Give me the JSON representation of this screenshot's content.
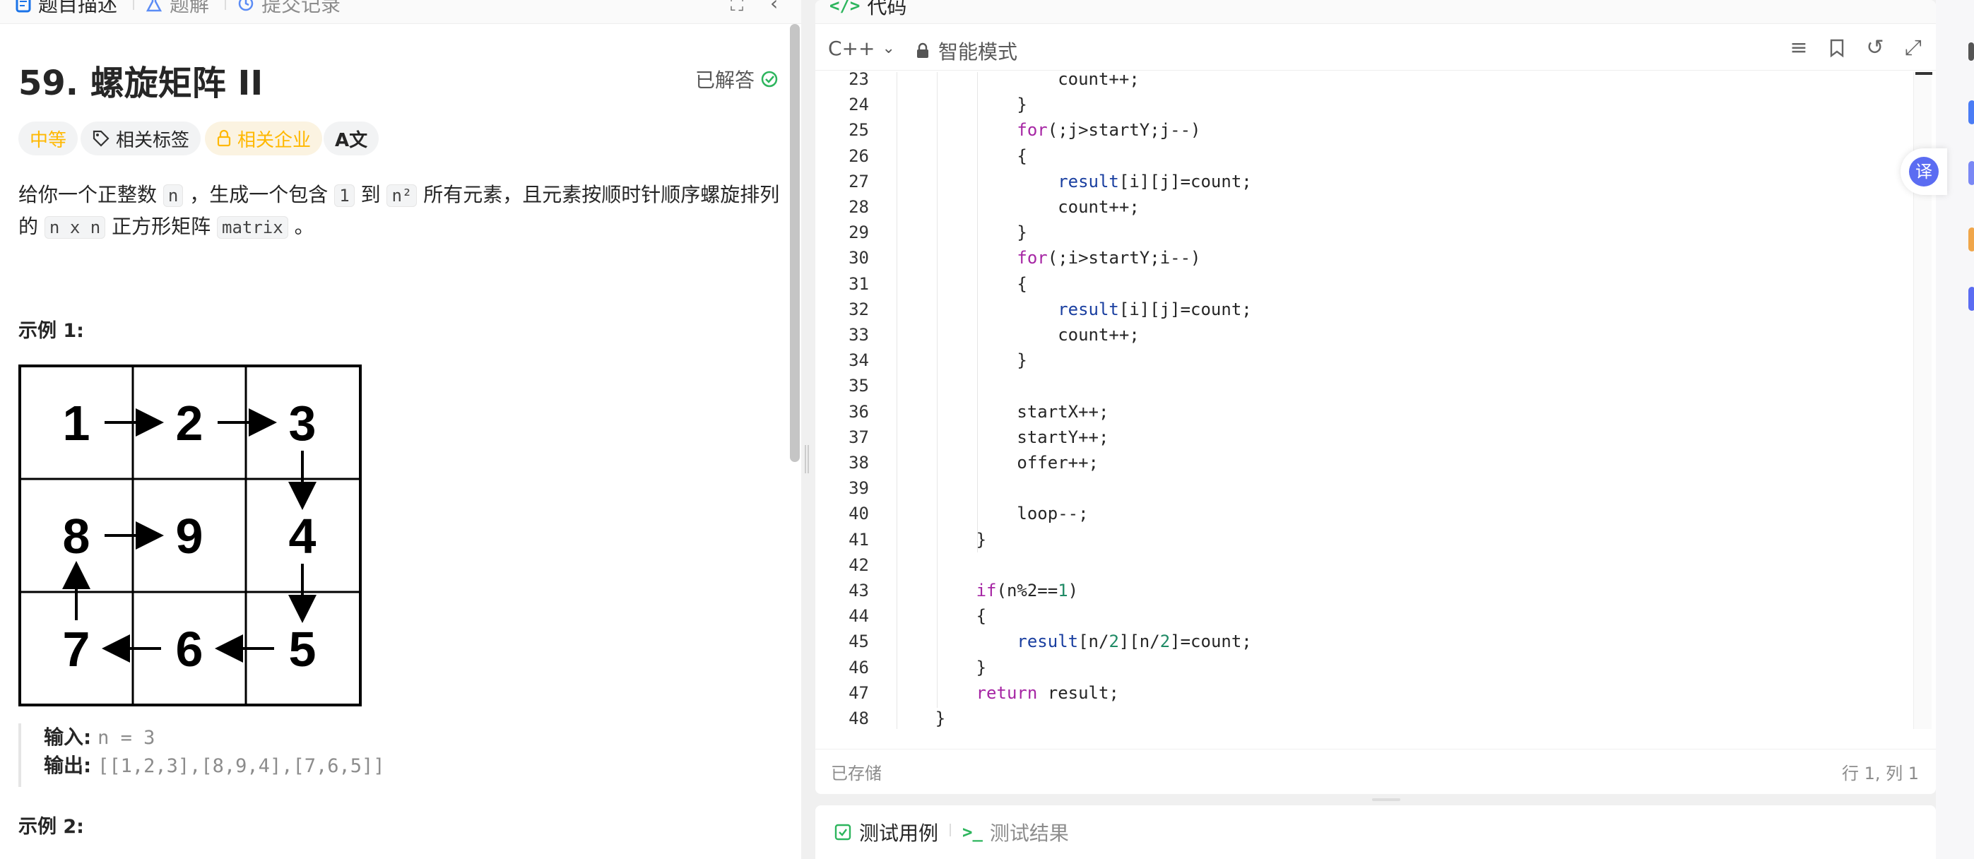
{
  "left_tabs": [
    "题目描述",
    "题解",
    "提交记录"
  ],
  "problem": {
    "title": "59. 螺旋矩阵 II",
    "status": "已解答",
    "tags": {
      "difficulty": "中等",
      "related_tags": "相关标签",
      "related_companies": "相关企业",
      "translate": "A文"
    },
    "desc": {
      "p1": "给你一个正整数",
      "n": "n",
      "p2": "，生成一个包含",
      "one": "1",
      "p3": "到",
      "n2": "n²",
      "p4": "所有元素，且元素按顺时针顺序螺旋排列",
      "p5": "的",
      "nxn": "n x n",
      "p6": "正方形矩阵",
      "matrix": "matrix",
      "p7": "。"
    },
    "example1_heading": "示例 1:",
    "grid_numbers": [
      "1",
      "2",
      "3",
      "8",
      "9",
      "4",
      "7",
      "6",
      "5"
    ],
    "input_label": "输入:",
    "input_value": "n = 3",
    "output_label": "输出:",
    "output_value": "[[1,2,3],[8,9,4],[7,6,5]]",
    "example2_heading": "示例 2:"
  },
  "code_panel": {
    "title": "代码",
    "language": "C++",
    "mode": "智能模式",
    "status_saved": "已存储",
    "cursor_position": "行 1, 列 1",
    "lines": [
      {
        "n": "23",
        "text": "                count++;"
      },
      {
        "n": "24",
        "text": "            }"
      },
      {
        "n": "25",
        "text": "            for(;j>startY;j--)"
      },
      {
        "n": "26",
        "text": "            {"
      },
      {
        "n": "27",
        "text": "                result[i][j]=count;"
      },
      {
        "n": "28",
        "text": "                count++;"
      },
      {
        "n": "29",
        "text": "            }"
      },
      {
        "n": "30",
        "text": "            for(;i>startY;i--)"
      },
      {
        "n": "31",
        "text": "            {"
      },
      {
        "n": "32",
        "text": "                result[i][j]=count;"
      },
      {
        "n": "33",
        "text": "                count++;"
      },
      {
        "n": "34",
        "text": "            }"
      },
      {
        "n": "35",
        "text": ""
      },
      {
        "n": "36",
        "text": "            startX++;"
      },
      {
        "n": "37",
        "text": "            startY++;"
      },
      {
        "n": "38",
        "text": "            offer++;"
      },
      {
        "n": "39",
        "text": ""
      },
      {
        "n": "40",
        "text": "            loop--;"
      },
      {
        "n": "41",
        "text": "        }"
      },
      {
        "n": "42",
        "text": ""
      },
      {
        "n": "43",
        "text": "        if(n%2==1)"
      },
      {
        "n": "44",
        "text": "        {"
      },
      {
        "n": "45",
        "text": "            result[n/2][n/2]=count;"
      },
      {
        "n": "46",
        "text": "        }"
      },
      {
        "n": "47",
        "text": "        return result;"
      },
      {
        "n": "48",
        "text": "    }"
      }
    ]
  },
  "test_panel": {
    "tab1": "测试用例",
    "tab2": "测试结果"
  },
  "translate_button": "译",
  "colors": {
    "keyword": "#a626a4",
    "identifier": "#1a3fa0",
    "number": "#1f8a65",
    "accent_green": "#2db55d",
    "difficulty": "#ffb800"
  }
}
